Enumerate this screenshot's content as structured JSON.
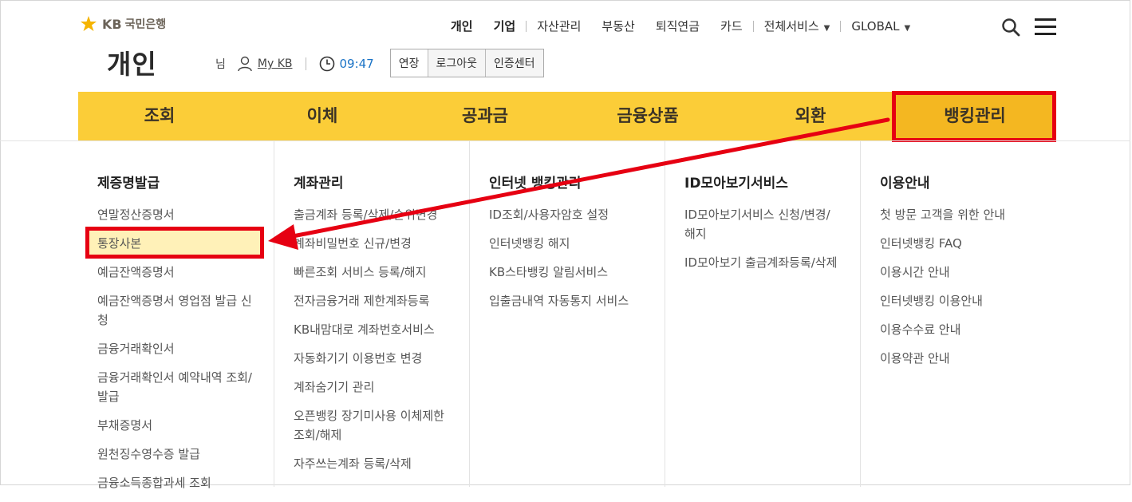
{
  "brand": {
    "kb": "KB",
    "name": "국민은행"
  },
  "topnav": {
    "items": [
      {
        "label": "개인"
      },
      {
        "label": "기업"
      },
      {
        "label": "자산관리"
      },
      {
        "label": "부동산"
      },
      {
        "label": "퇴직연금"
      },
      {
        "label": "카드"
      },
      {
        "label": "전체서비스"
      },
      {
        "label": "GLOBAL"
      }
    ]
  },
  "header": {
    "title": "개인",
    "user_suffix": "님",
    "mykb": "My KB",
    "timer": "09:47",
    "buttons": [
      "연장",
      "로그아웃",
      "인증센터"
    ]
  },
  "mainmenu": {
    "tabs": [
      "조회",
      "이체",
      "공과금",
      "금융상품",
      "외환",
      "뱅킹관리"
    ],
    "active_index": 5
  },
  "submenu": [
    {
      "heading": "제증명발급",
      "items": [
        "연말정산증명서",
        "통장사본",
        "예금잔액증명서",
        "예금잔액증명서 영업점 발급 신청",
        "금융거래확인서",
        "금융거래확인서 예약내역 조회/발급",
        "부채증명서",
        "원천징수영수증 발급",
        "금융소득종합과세 조회"
      ]
    },
    {
      "heading": "계좌관리",
      "items": [
        "출금계좌 등록/삭제/순위변경",
        "계좌비밀번호 신규/변경",
        "빠른조회 서비스 등록/해지",
        "전자금융거래 제한계좌등록",
        "KB내맘대로 계좌번호서비스",
        "자동화기기 이용번호 변경",
        "계좌숨기기 관리",
        "오픈뱅킹 장기미사용 이체제한 조회/해제",
        "자주쓰는계좌 등록/삭제"
      ]
    },
    {
      "heading": "인터넷 뱅킹관리",
      "items": [
        "ID조회/사용자암호 설정",
        "인터넷뱅킹 해지",
        "KB스타뱅킹 알림서비스",
        "입출금내역 자동통지 서비스"
      ]
    },
    {
      "heading": "ID모아보기서비스",
      "items": [
        "ID모아보기서비스 신청/변경/해지",
        "ID모아보기 출금계좌등록/삭제"
      ]
    },
    {
      "heading": "이용안내",
      "items": [
        "첫 방문 고객을 위한 안내",
        "인터넷뱅킹 FAQ",
        "이용시간 안내",
        "인터넷뱅킹 이용안내",
        "이용수수료 안내",
        "이용약관 안내"
      ]
    }
  ],
  "colors": {
    "menu_yellow": "#fbcd38",
    "active_yellow": "#f4b721",
    "highlight_red": "#e60012",
    "timer_blue": "#1a73c6"
  }
}
